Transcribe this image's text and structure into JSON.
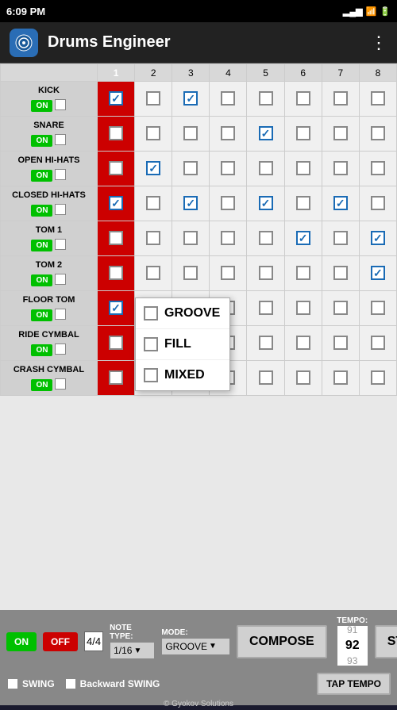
{
  "statusBar": {
    "time": "6:09 PM",
    "battery": "⬜",
    "signal": "▂▄▆"
  },
  "header": {
    "title": "Drums Engineer",
    "logo": "D",
    "menuIcon": "⋮"
  },
  "rows": [
    {
      "name": "KICK",
      "on": true,
      "beats": [
        true,
        false,
        true,
        false,
        false,
        false,
        false,
        false
      ],
      "beat1checked": true
    },
    {
      "name": "SNARE",
      "on": true,
      "beats": [
        false,
        false,
        false,
        false,
        true,
        false,
        false,
        false
      ],
      "beat1checked": false
    },
    {
      "name": "OPEN HI-HATS",
      "on": true,
      "beats": [
        false,
        true,
        false,
        false,
        false,
        false,
        false,
        false
      ],
      "beat1checked": false
    },
    {
      "name": "CLOSED HI-HATS",
      "on": true,
      "beats": [
        true,
        false,
        true,
        false,
        true,
        false,
        true,
        false
      ],
      "beat1checked": true
    },
    {
      "name": "TOM 1",
      "on": true,
      "beats": [
        false,
        false,
        false,
        false,
        false,
        true,
        false,
        true
      ],
      "beat1checked": false
    },
    {
      "name": "TOM 2",
      "on": true,
      "beats": [
        false,
        false,
        false,
        false,
        false,
        false,
        false,
        true
      ],
      "beat1checked": false
    },
    {
      "name": "FLOOR TOM",
      "on": true,
      "beats": [
        false,
        false,
        false,
        false,
        false,
        false,
        false,
        false
      ],
      "beat1checked": true
    },
    {
      "name": "RIDE CYMBAL",
      "on": true,
      "beats": [
        false,
        false,
        false,
        false,
        false,
        false,
        false,
        false
      ],
      "beat1checked": false
    },
    {
      "name": "CRASH CYMBAL",
      "on": true,
      "beats": [
        false,
        false,
        false,
        false,
        false,
        false,
        false,
        false
      ],
      "beat1checked": false
    }
  ],
  "beatNumbers": [
    "1",
    "2",
    "3",
    "4",
    "5",
    "6",
    "7",
    "8"
  ],
  "dropdown": {
    "items": [
      "GROOVE",
      "FILL",
      "MIXED"
    ]
  },
  "toolbar": {
    "onLabel": "ON",
    "offLabel": "OFF",
    "timeSig": "4/4",
    "noteTypeLabel": "NOTE TYPE:",
    "noteTypeValue": "1/16",
    "modeLabel": "MODE:",
    "modeValue": "GROOVE",
    "composeLabel": "COMPOSE",
    "tempoLabel": "TEMPO:",
    "tempoPrev": "91",
    "tempoCurrent": "92",
    "tempoNext": "93",
    "stopLabel": "STOP",
    "swingLabel": "SWING",
    "backwardSwingLabel": "Backward SWING",
    "tapTempoLabel": "TAP TEMPO",
    "copyright": "© Gyokov Solutions"
  }
}
